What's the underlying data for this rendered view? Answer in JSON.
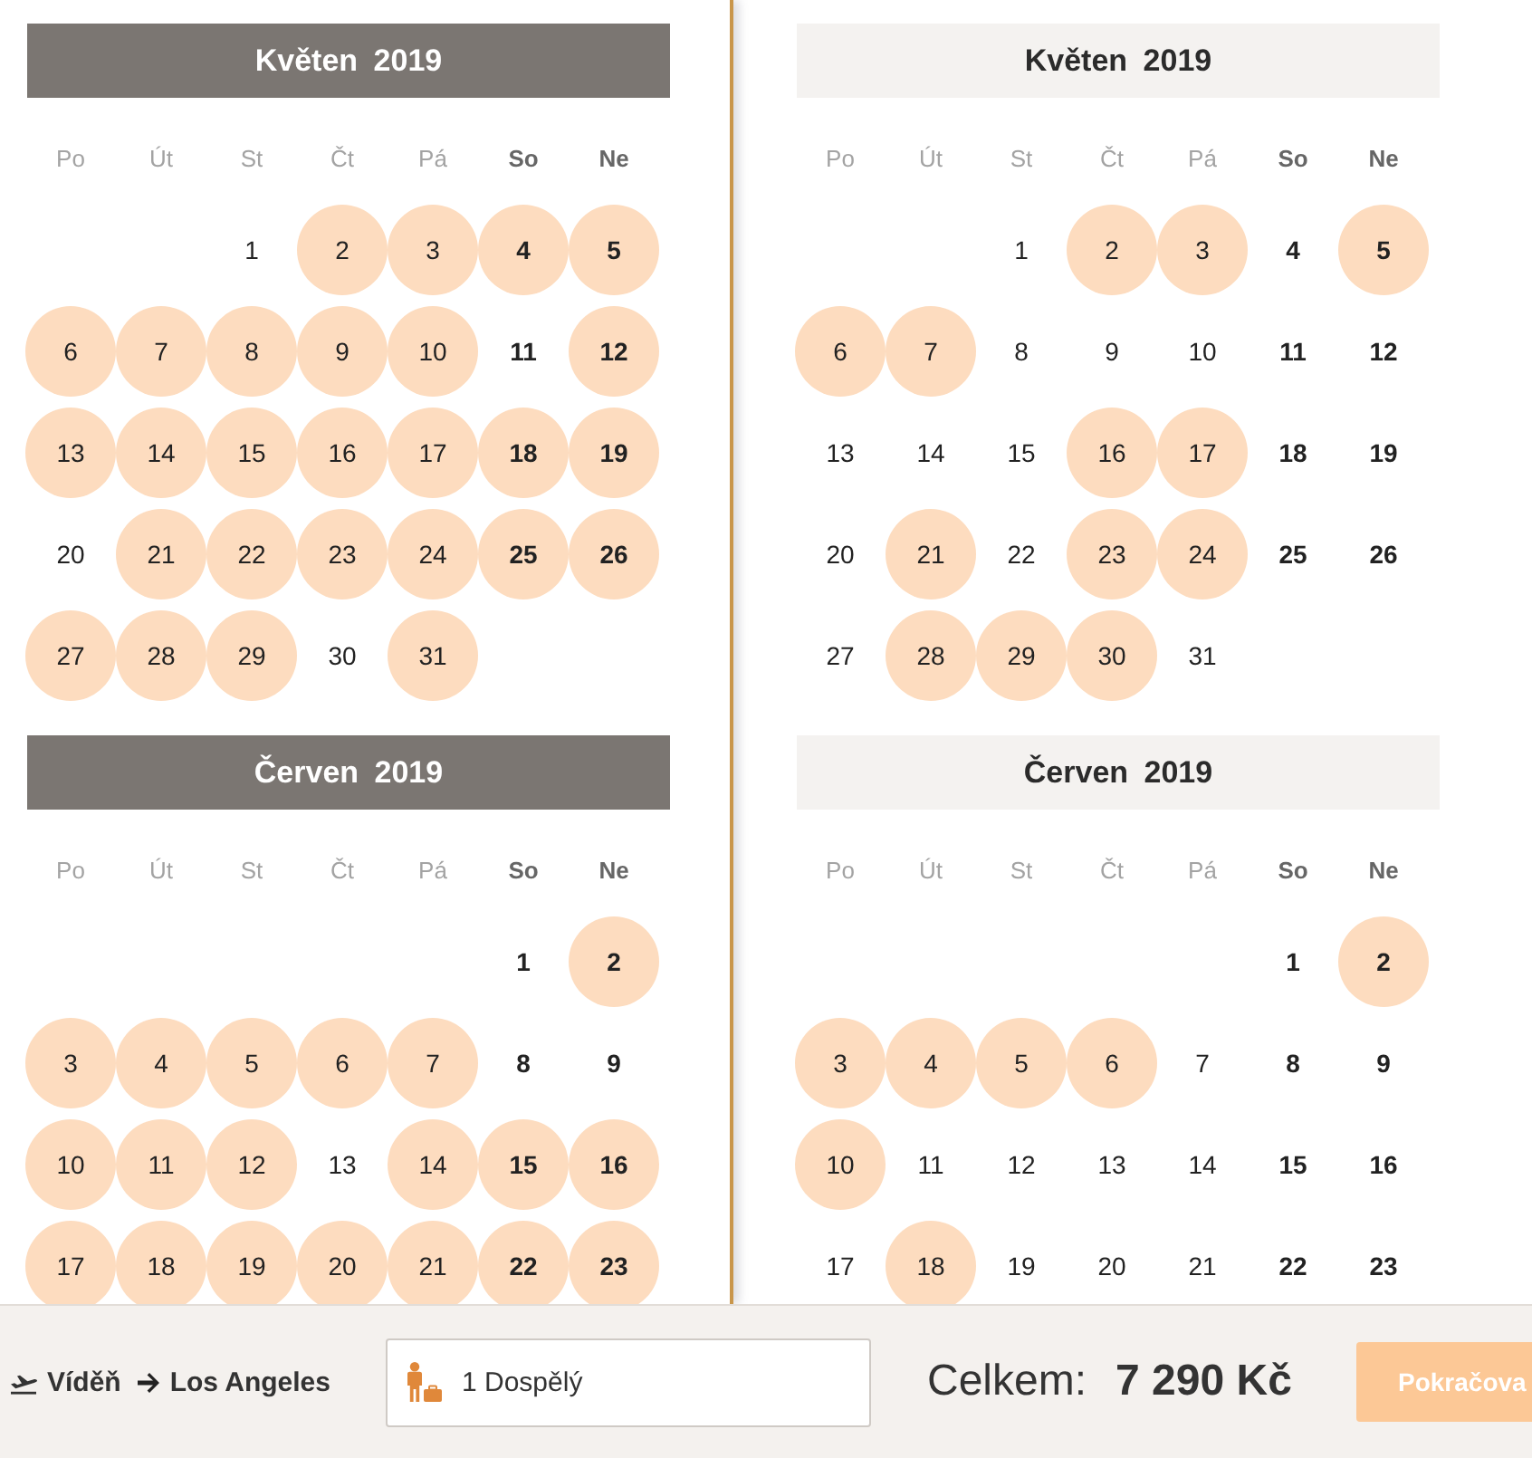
{
  "panels": [
    {
      "active": true,
      "months": [
        {
          "title": "Květen 2019",
          "weekdays": [
            "Po",
            "Út",
            "St",
            "Čt",
            "Pá",
            "So",
            "Ne"
          ],
          "weeks": [
            {
              "days": [
                {
                  "label": "1",
                  "available": false
                },
                {
                  "label": "2",
                  "available": true
                },
                {
                  "label": "3",
                  "available": true
                },
                {
                  "label": "4",
                  "available": true
                },
                {
                  "label": "5",
                  "available": true
                }
              ]
            },
            {
              "days": [
                {
                  "label": "6",
                  "available": true
                },
                {
                  "label": "7",
                  "available": true
                },
                {
                  "label": "8",
                  "available": true
                },
                {
                  "label": "9",
                  "available": true
                },
                {
                  "label": "10",
                  "available": true
                },
                {
                  "label": "11",
                  "available": false
                },
                {
                  "label": "12",
                  "available": true
                }
              ]
            },
            {
              "days": [
                {
                  "label": "13",
                  "available": true
                },
                {
                  "label": "14",
                  "available": true
                },
                {
                  "label": "15",
                  "available": true
                },
                {
                  "label": "16",
                  "available": true
                },
                {
                  "label": "17",
                  "available": true
                },
                {
                  "label": "18",
                  "available": true
                },
                {
                  "label": "19",
                  "available": true
                }
              ]
            },
            {
              "days": [
                {
                  "label": "20",
                  "available": false
                },
                {
                  "label": "21",
                  "available": true
                },
                {
                  "label": "22",
                  "available": true
                },
                {
                  "label": "23",
                  "available": true
                },
                {
                  "label": "24",
                  "available": true
                },
                {
                  "label": "25",
                  "available": true
                },
                {
                  "label": "26",
                  "available": true
                }
              ]
            },
            {
              "days": [
                {
                  "label": "27",
                  "available": true
                },
                {
                  "label": "28",
                  "available": true
                },
                {
                  "label": "29",
                  "available": true
                },
                {
                  "label": "30",
                  "available": false
                },
                {
                  "label": "31",
                  "available": true
                }
              ]
            }
          ]
        },
        {
          "title": "Červen 2019",
          "weekdays": [
            "Po",
            "Út",
            "St",
            "Čt",
            "Pá",
            "So",
            "Ne"
          ],
          "weeks": [
            {
              "days": [
                {
                  "label": "1",
                  "available": false
                },
                {
                  "label": "2",
                  "available": true
                }
              ]
            },
            {
              "days": [
                {
                  "label": "3",
                  "available": true
                },
                {
                  "label": "4",
                  "available": true
                },
                {
                  "label": "5",
                  "available": true
                },
                {
                  "label": "6",
                  "available": true
                },
                {
                  "label": "7",
                  "available": true
                },
                {
                  "label": "8",
                  "available": false
                },
                {
                  "label": "9",
                  "available": false
                }
              ]
            },
            {
              "days": [
                {
                  "label": "10",
                  "available": true
                },
                {
                  "label": "11",
                  "available": true
                },
                {
                  "label": "12",
                  "available": true
                },
                {
                  "label": "13",
                  "available": false
                },
                {
                  "label": "14",
                  "available": true
                },
                {
                  "label": "15",
                  "available": true
                },
                {
                  "label": "16",
                  "available": true
                }
              ]
            },
            {
              "days": [
                {
                  "label": "17",
                  "available": true
                },
                {
                  "label": "18",
                  "available": true
                },
                {
                  "label": "19",
                  "available": true
                },
                {
                  "label": "20",
                  "available": true
                },
                {
                  "label": "21",
                  "available": true
                },
                {
                  "label": "22",
                  "available": true
                },
                {
                  "label": "23",
                  "available": true
                }
              ]
            }
          ]
        }
      ]
    },
    {
      "active": false,
      "months": [
        {
          "title": "Květen 2019",
          "weekdays": [
            "Po",
            "Út",
            "St",
            "Čt",
            "Pá",
            "So",
            "Ne"
          ],
          "weeks": [
            {
              "days": [
                {
                  "label": "1",
                  "available": false
                },
                {
                  "label": "2",
                  "available": true
                },
                {
                  "label": "3",
                  "available": true
                },
                {
                  "label": "4",
                  "available": false
                },
                {
                  "label": "5",
                  "available": true
                }
              ]
            },
            {
              "days": [
                {
                  "label": "6",
                  "available": true
                },
                {
                  "label": "7",
                  "available": true
                },
                {
                  "label": "8",
                  "available": false
                },
                {
                  "label": "9",
                  "available": false
                },
                {
                  "label": "10",
                  "available": false
                },
                {
                  "label": "11",
                  "available": false
                },
                {
                  "label": "12",
                  "available": false
                }
              ]
            },
            {
              "days": [
                {
                  "label": "13",
                  "available": false
                },
                {
                  "label": "14",
                  "available": false
                },
                {
                  "label": "15",
                  "available": false
                },
                {
                  "label": "16",
                  "available": true
                },
                {
                  "label": "17",
                  "available": true
                },
                {
                  "label": "18",
                  "available": false
                },
                {
                  "label": "19",
                  "available": false
                }
              ]
            },
            {
              "days": [
                {
                  "label": "20",
                  "available": false
                },
                {
                  "label": "21",
                  "available": true
                },
                {
                  "label": "22",
                  "available": false
                },
                {
                  "label": "23",
                  "available": true
                },
                {
                  "label": "24",
                  "available": true
                },
                {
                  "label": "25",
                  "available": false
                },
                {
                  "label": "26",
                  "available": false
                }
              ]
            },
            {
              "days": [
                {
                  "label": "27",
                  "available": false
                },
                {
                  "label": "28",
                  "available": true
                },
                {
                  "label": "29",
                  "available": true
                },
                {
                  "label": "30",
                  "available": true
                },
                {
                  "label": "31",
                  "available": false
                }
              ]
            }
          ]
        },
        {
          "title": "Červen 2019",
          "weekdays": [
            "Po",
            "Út",
            "St",
            "Čt",
            "Pá",
            "So",
            "Ne"
          ],
          "weeks": [
            {
              "days": [
                {
                  "label": "1",
                  "available": false
                },
                {
                  "label": "2",
                  "available": true
                }
              ]
            },
            {
              "days": [
                {
                  "label": "3",
                  "available": true
                },
                {
                  "label": "4",
                  "available": true
                },
                {
                  "label": "5",
                  "available": true
                },
                {
                  "label": "6",
                  "available": true
                },
                {
                  "label": "7",
                  "available": false
                },
                {
                  "label": "8",
                  "available": false
                },
                {
                  "label": "9",
                  "available": false
                }
              ]
            },
            {
              "days": [
                {
                  "label": "10",
                  "available": true
                },
                {
                  "label": "11",
                  "available": false
                },
                {
                  "label": "12",
                  "available": false
                },
                {
                  "label": "13",
                  "available": false
                },
                {
                  "label": "14",
                  "available": false
                },
                {
                  "label": "15",
                  "available": false
                },
                {
                  "label": "16",
                  "available": false
                }
              ]
            },
            {
              "days": [
                {
                  "label": "17",
                  "available": false
                },
                {
                  "label": "18",
                  "available": true
                },
                {
                  "label": "19",
                  "available": false
                },
                {
                  "label": "20",
                  "available": false
                },
                {
                  "label": "21",
                  "available": false
                },
                {
                  "label": "22",
                  "available": false
                },
                {
                  "label": "23",
                  "available": false
                }
              ]
            }
          ]
        }
      ]
    }
  ],
  "route": {
    "from": "Víděň",
    "to": "Los Angeles"
  },
  "passengers": {
    "value": "1 Dospělý"
  },
  "total": {
    "label": "Celkem:",
    "value": "7 290 Kč"
  },
  "continue_button": {
    "label": "Pokračova"
  }
}
